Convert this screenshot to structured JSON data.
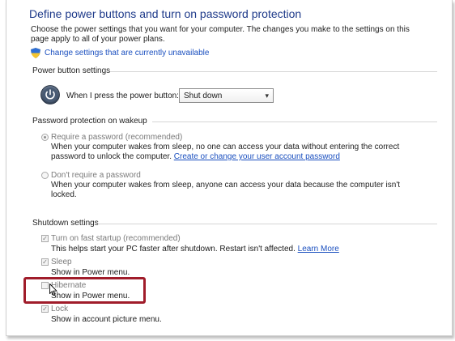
{
  "page": {
    "title": "Define power buttons and turn on password protection",
    "description_line1": "Choose the power settings that you want for your computer. The changes you make to the settings on this",
    "description_line2": "page apply to all of your power plans.",
    "change_settings_link": "Change settings that are currently unavailable"
  },
  "power_button": {
    "section_title": "Power button settings",
    "label": "When I press the power button:",
    "selected_value": "Shut down"
  },
  "password": {
    "section_title": "Password protection on wakeup",
    "require_label": "Require a password (recommended)",
    "require_desc_line1": "When your computer wakes from sleep, no one can access your data without entering the correct",
    "require_desc_line2_prefix": "password to unlock the computer.",
    "require_link": "Create or change your user account password",
    "no_require_label": "Don't require a password",
    "no_require_desc_line1": "When your computer wakes from sleep, anyone can access your data because the computer isn't",
    "no_require_desc_line2": "locked."
  },
  "shutdown": {
    "section_title": "Shutdown settings",
    "items": [
      {
        "label": "Turn on fast startup (recommended)",
        "desc": "This helps start your PC faster after shutdown. Restart isn't affected.",
        "link": "Learn More",
        "checked": true
      },
      {
        "label": "Sleep",
        "desc": "Show in Power menu.",
        "checked": true
      },
      {
        "label": "Hibernate",
        "desc": "Show in Power menu.",
        "checked": false
      },
      {
        "label": "Lock",
        "desc": "Show in account picture menu.",
        "checked": true
      }
    ]
  },
  "colors": {
    "title": "#1e3a8a",
    "link": "#1a4fbf",
    "highlight": "#a01c2a"
  },
  "icons": {
    "shield": "uac-shield-icon",
    "power": "power-button-icon",
    "cursor": "mouse-pointer-icon"
  }
}
